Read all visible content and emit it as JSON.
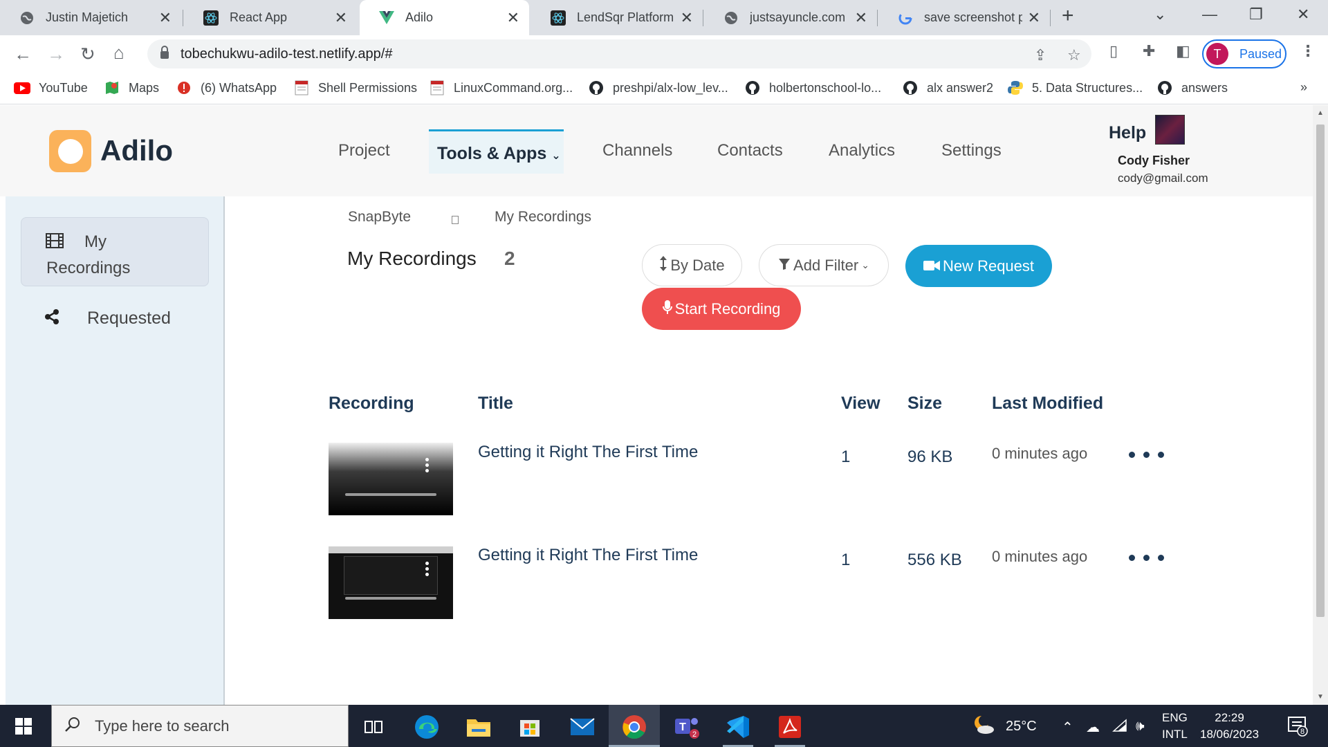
{
  "browser": {
    "tabs": [
      {
        "title": "Justin Majetich",
        "active": false
      },
      {
        "title": "React App",
        "active": false
      },
      {
        "title": "Adilo",
        "active": true
      },
      {
        "title": "LendSqr Platform",
        "active": false
      },
      {
        "title": "justsayuncle.com",
        "active": false
      },
      {
        "title": "save screenshot pc",
        "active": false
      }
    ],
    "url": "tobechukwu-adilo-test.netlify.app/#",
    "profile_initial": "T",
    "profile_status": "Paused",
    "bookmarks": [
      "YouTube",
      "Maps",
      "(6) WhatsApp",
      "Shell Permissions",
      "LinuxCommand.org...",
      "preshpi/alx-low_lev...",
      "holbertonschool-lo...",
      "alx answer2",
      "5. Data Structures...",
      "answers"
    ],
    "bookmarks_overflow": "»"
  },
  "app": {
    "logo_text": "Adilo",
    "nav": {
      "project": "Project",
      "tools": "Tools & Apps",
      "channels": "Channels",
      "contacts": "Contacts",
      "analytics": "Analytics",
      "settings": "Settings"
    },
    "help": "Help",
    "user": {
      "name": "Cody Fisher",
      "email": "cody@gmail.com"
    },
    "sidebar": {
      "my_recordings": "My Recordings",
      "requested": "Requested"
    },
    "breadcrumb": {
      "root": "SnapByte",
      "current": "My Recordings"
    },
    "title": "My Recordings",
    "count": "2",
    "buttons": {
      "by_date": "By Date",
      "add_filter": "Add Filter",
      "new_request": "New Request",
      "start_recording": "Start Recording"
    },
    "table": {
      "headers": {
        "recording": "Recording",
        "title": "Title",
        "view": "View",
        "size": "Size",
        "modified": "Last Modified"
      },
      "rows": [
        {
          "title": "Getting it Right The First Time",
          "view": "1",
          "size": "96 KB",
          "modified": "0 minutes ago"
        },
        {
          "title": "Getting it Right The First Time",
          "view": "1",
          "size": "556 KB",
          "modified": "0 minutes ago"
        }
      ]
    }
  },
  "taskbar": {
    "search_placeholder": "Type here to search",
    "weather": "25°C",
    "lang1": "ENG",
    "lang2": "INTL",
    "time": "22:29",
    "date": "18/06/2023",
    "notification_count": "8",
    "teams_badge": "2"
  },
  "colors": {
    "accent_blue": "#1aa0d4",
    "record_red": "#ef4f4f",
    "logo_orange": "#fbb25a",
    "heading_navy": "#1f3a57"
  }
}
